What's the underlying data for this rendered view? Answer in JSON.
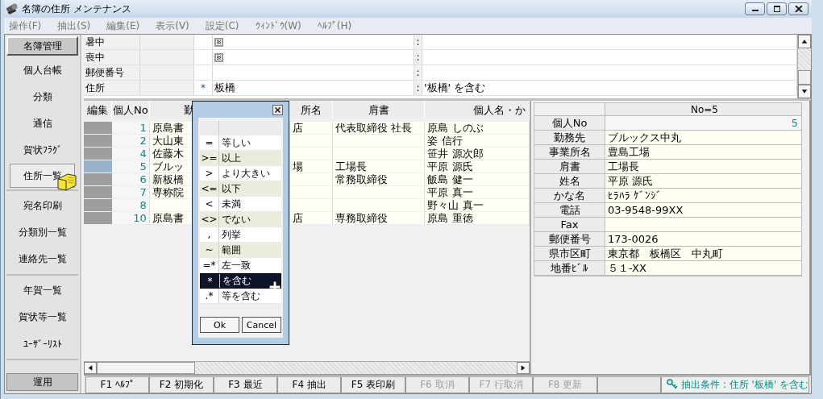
{
  "window": {
    "title": "名簿の住所 メンテナンス"
  },
  "menu": [
    "操作(F)",
    "抽出(S)",
    "編集(E)",
    "表示(V)",
    "設定(C)",
    "ｳｨﾝﾄﾞｳ(W)",
    "ﾍﾙﾌﾟ(H)"
  ],
  "sidebar": {
    "title": "名簿管理",
    "groups": [
      {
        "items": [
          {
            "label": "個人台帳",
            "selected": false
          },
          {
            "label": "分類",
            "selected": false
          },
          {
            "label": "通信",
            "selected": false
          },
          {
            "label": "賀状ﾌﾗｸﾞ",
            "selected": false
          },
          {
            "label": "住所一覧",
            "selected": true
          }
        ]
      },
      {
        "items": [
          {
            "label": "宛名印刷",
            "selected": false
          },
          {
            "label": "分類別一覧",
            "selected": false
          },
          {
            "label": "連絡先一覧",
            "selected": false
          }
        ]
      },
      {
        "items": [
          {
            "label": "年賀一覧",
            "selected": false
          },
          {
            "label": "賀状等一覧",
            "selected": false
          },
          {
            "label": "ﾕｰｻﾞｰﾘｽﾄ",
            "selected": false
          }
        ]
      }
    ],
    "footer": "運用"
  },
  "criteria": [
    {
      "label": "暑中",
      "kind": "flag",
      "indeterminate": true,
      "separator": ":"
    },
    {
      "label": "喪中",
      "kind": "flag",
      "indeterminate": true,
      "separator": ":"
    },
    {
      "label": "郵便番号",
      "kind": "text",
      "separator": ":"
    },
    {
      "label": "住所",
      "kind": "text",
      "operator": "*",
      "value": "板橋",
      "separator": ":",
      "description": "'板橋' を含む"
    }
  ],
  "list": {
    "columns": [
      "編集",
      "個人No",
      "勤",
      "所名",
      "肩書",
      "個人名・か"
    ],
    "rows": [
      {
        "selected": false,
        "no": "1",
        "company": "原島書",
        "office": "店",
        "title": "代表取締役 社長",
        "name": "原島 しのぶ"
      },
      {
        "selected": false,
        "no": "2",
        "company": "大山東",
        "name": "姿 信行"
      },
      {
        "selected": false,
        "no": "4",
        "company": "佐藤木",
        "name": "笹井 源次郎"
      },
      {
        "selected": true,
        "no": "5",
        "company": "ブルッ",
        "office": "場",
        "title": "工場長",
        "name": "平原 源氏"
      },
      {
        "selected": false,
        "no": "6",
        "company": "新板橋",
        "title": "常務取締役",
        "name": "飯島 健一"
      },
      {
        "selected": false,
        "no": "7",
        "company": "専称院",
        "name": "平原 真一"
      },
      {
        "selected": false,
        "no": "8",
        "name": "野々山 真一"
      },
      {
        "selected": false,
        "no": "10",
        "company": "原島書",
        "office": "店",
        "title": "専務取締役",
        "name": "原島 重徳"
      }
    ]
  },
  "detail": {
    "header": "No=5",
    "fields": [
      {
        "label": "個人No",
        "value": "5",
        "kind": "number"
      },
      {
        "label": "勤務先",
        "value": "ブルックス中丸",
        "kind": "text"
      },
      {
        "label": "事業所名",
        "value": "豊島工場",
        "kind": "text"
      },
      {
        "label": "肩書",
        "value": "工場長",
        "kind": "text"
      },
      {
        "label": "姓名",
        "value": "平原 源氏",
        "kind": "text"
      },
      {
        "label": "かな名",
        "value": "ﾋﾗﾊﾗ ｹﾞﾝｼﾞ",
        "kind": "text"
      },
      {
        "label": "電話",
        "value": "03-9548-99XX",
        "kind": "text"
      },
      {
        "label": "Fax",
        "kind": "text"
      },
      {
        "label": "郵便番号",
        "value": "173-0026",
        "kind": "text"
      },
      {
        "label": "県市区町",
        "value": "東京都　板橋区　中丸町",
        "kind": "text"
      },
      {
        "label": "地番ﾋﾞﾙ",
        "value": "５１-XX",
        "kind": "text"
      }
    ]
  },
  "operator_popup": {
    "operators": [
      {
        "symbol": "=",
        "label": "等しい",
        "shaded": false,
        "selected": false
      },
      {
        "symbol": ">=",
        "label": "以上",
        "shaded": true,
        "selected": false
      },
      {
        "symbol": ">",
        "label": "より大きい",
        "shaded": false,
        "selected": false
      },
      {
        "symbol": "<=",
        "label": "以下",
        "shaded": true,
        "selected": false
      },
      {
        "symbol": "<",
        "label": "未満",
        "shaded": false,
        "selected": false
      },
      {
        "symbol": "<>",
        "label": "でない",
        "shaded": true,
        "selected": false
      },
      {
        "symbol": ",",
        "label": "列挙",
        "shaded": false,
        "selected": false
      },
      {
        "symbol": "~",
        "label": "範囲",
        "shaded": true,
        "selected": false
      },
      {
        "symbol": "=*",
        "label": "左一致",
        "shaded": false,
        "selected": false
      },
      {
        "symbol": "*",
        "label": "を含む",
        "shaded": false,
        "selected": true
      },
      {
        "symbol": ".*",
        "label": "等を含む",
        "shaded": false,
        "selected": false
      }
    ],
    "buttons": [
      "Ok",
      "Cancel"
    ]
  },
  "function_keys": [
    {
      "label": "F1 ﾍﾙﾌﾟ",
      "disabled": false
    },
    {
      "label": "F2 初期化",
      "disabled": false
    },
    {
      "label": "F3 最近",
      "disabled": false
    },
    {
      "label": "F4 抽出",
      "disabled": false
    },
    {
      "label": "F5 表印刷",
      "disabled": false
    },
    {
      "label": "F6 取消",
      "disabled": true
    },
    {
      "label": "F7 行取消",
      "disabled": true
    },
    {
      "label": "F8 更新",
      "disabled": true
    }
  ],
  "status": "抽出条件 : 住所 '板橋' を含む"
}
